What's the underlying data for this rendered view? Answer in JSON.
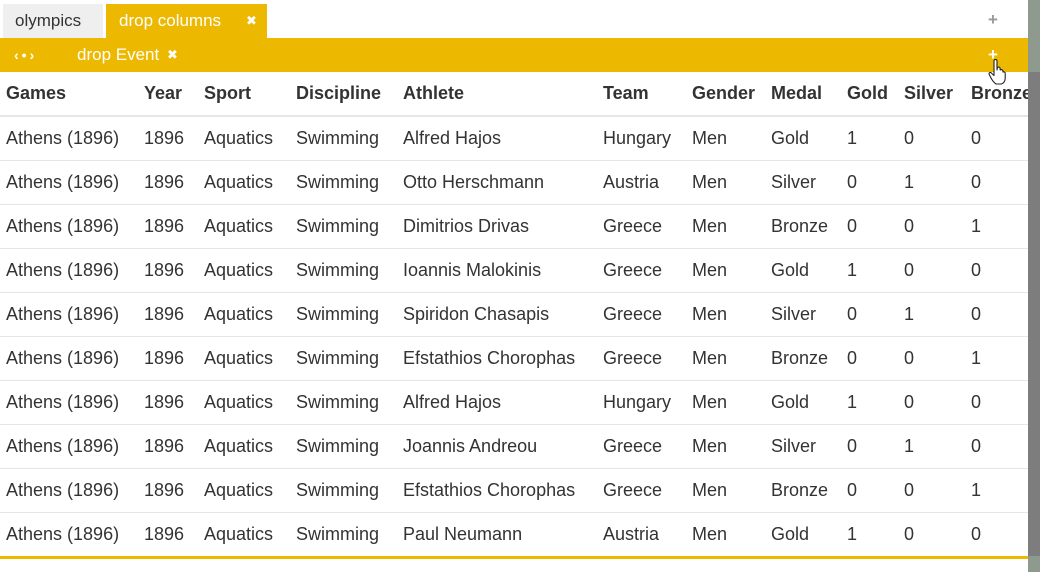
{
  "tabs": {
    "olympics": "olympics",
    "drop_columns": "drop columns",
    "close_symbol": "✖",
    "add_symbol": "+"
  },
  "step_bar": {
    "nav": "‹•›",
    "label": "drop Event",
    "close_symbol": "✖",
    "add_symbol": "+"
  },
  "colors": {
    "accent": "#ecb900",
    "scrollbar": "#8f9a8f"
  },
  "table": {
    "headers": [
      "Games",
      "Year",
      "Sport",
      "Discipline",
      "Athlete",
      "Team",
      "Gender",
      "Medal",
      "Gold",
      "Silver",
      "Bronze"
    ],
    "rows": [
      [
        "Athens (1896)",
        "1896",
        "Aquatics",
        "Swimming",
        "Alfred Hajos",
        "Hungary",
        "Men",
        "Gold",
        "1",
        "0",
        "0"
      ],
      [
        "Athens (1896)",
        "1896",
        "Aquatics",
        "Swimming",
        "Otto Herschmann",
        "Austria",
        "Men",
        "Silver",
        "0",
        "1",
        "0"
      ],
      [
        "Athens (1896)",
        "1896",
        "Aquatics",
        "Swimming",
        "Dimitrios Drivas",
        "Greece",
        "Men",
        "Bronze",
        "0",
        "0",
        "1"
      ],
      [
        "Athens (1896)",
        "1896",
        "Aquatics",
        "Swimming",
        "Ioannis Malokinis",
        "Greece",
        "Men",
        "Gold",
        "1",
        "0",
        "0"
      ],
      [
        "Athens (1896)",
        "1896",
        "Aquatics",
        "Swimming",
        "Spiridon Chasapis",
        "Greece",
        "Men",
        "Silver",
        "0",
        "1",
        "0"
      ],
      [
        "Athens (1896)",
        "1896",
        "Aquatics",
        "Swimming",
        "Efstathios Chorophas",
        "Greece",
        "Men",
        "Bronze",
        "0",
        "0",
        "1"
      ],
      [
        "Athens (1896)",
        "1896",
        "Aquatics",
        "Swimming",
        "Alfred Hajos",
        "Hungary",
        "Men",
        "Gold",
        "1",
        "0",
        "0"
      ],
      [
        "Athens (1896)",
        "1896",
        "Aquatics",
        "Swimming",
        "Joannis Andreou",
        "Greece",
        "Men",
        "Silver",
        "0",
        "1",
        "0"
      ],
      [
        "Athens (1896)",
        "1896",
        "Aquatics",
        "Swimming",
        "Efstathios Chorophas",
        "Greece",
        "Men",
        "Bronze",
        "0",
        "0",
        "1"
      ],
      [
        "Athens (1896)",
        "1896",
        "Aquatics",
        "Swimming",
        "Paul Neumann",
        "Austria",
        "Men",
        "Gold",
        "1",
        "0",
        "0"
      ]
    ]
  }
}
